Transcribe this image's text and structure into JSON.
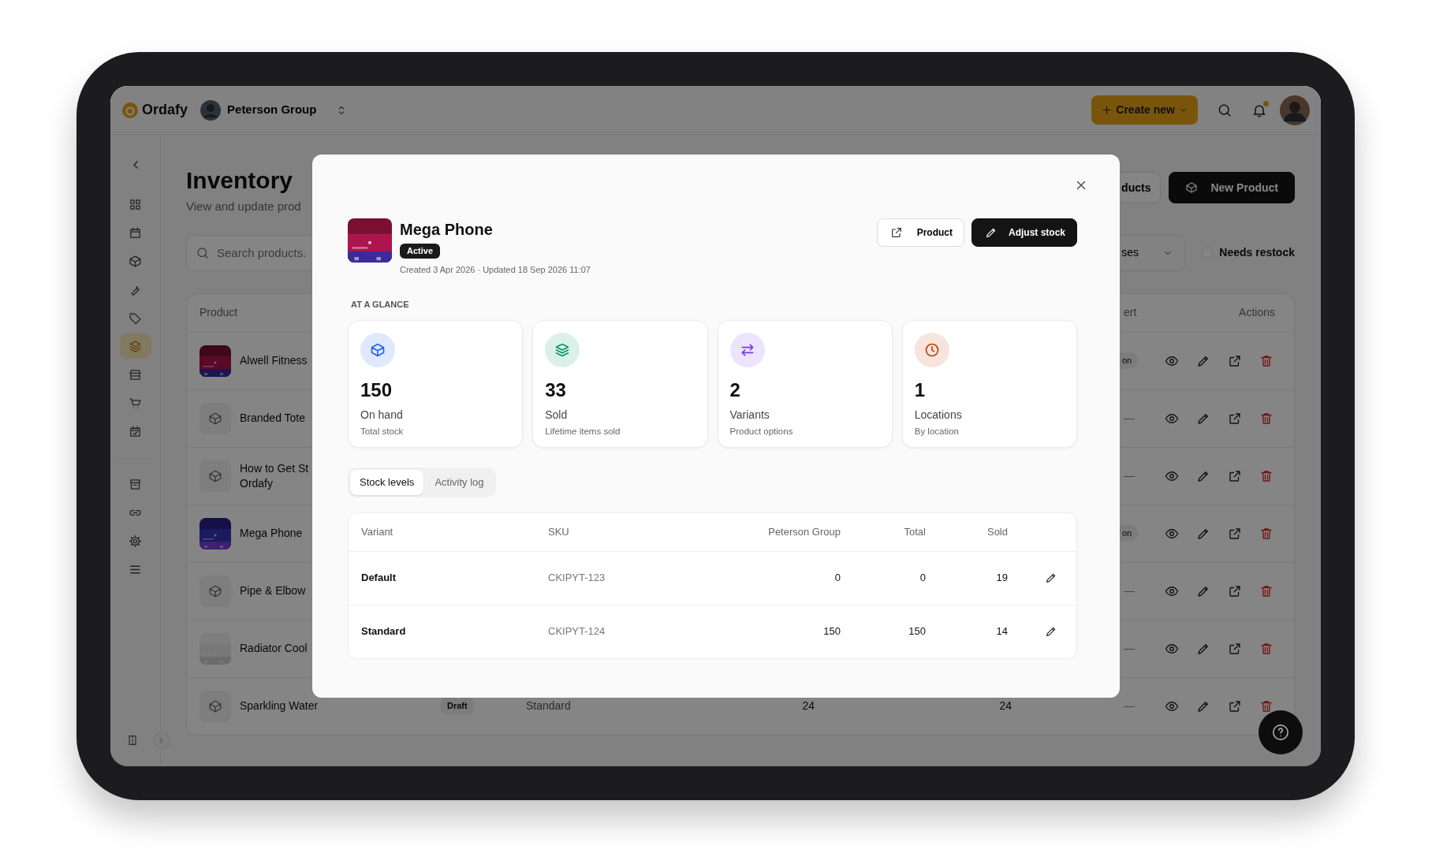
{
  "app": {
    "name": "Ordafy",
    "workspace": "Peterson Group",
    "create_button": "Create new",
    "notifications_unread": true
  },
  "sidebar": {
    "primary": [
      {
        "selected": false
      },
      {
        "selected": false
      },
      {
        "selected": false
      },
      {
        "selected": false
      },
      {
        "selected": false
      },
      {
        "selected": true
      },
      {
        "selected": false
      },
      {
        "selected": false
      },
      {
        "selected": false
      }
    ],
    "secondary": [
      {
        "selected": false
      },
      {
        "selected": false
      },
      {
        "selected": false
      },
      {
        "selected": false
      }
    ]
  },
  "page": {
    "title": "Inventory",
    "subtitle": "View and update prod",
    "buttons": [
      {
        "label": "ducts",
        "kind": "outline"
      },
      {
        "label": "New Product",
        "kind": "primary"
      }
    ],
    "search": {
      "placeholder": "Search products."
    },
    "filter": {
      "value": "ses"
    },
    "needs_restock": {
      "label": "Needs restock",
      "checked": false
    }
  },
  "table": {
    "columns": [
      "Product",
      "ert",
      "Actions"
    ],
    "rows": [
      {
        "name": "Alwell Fitness",
        "kind": "picture",
        "alert": {
          "kind": "badge",
          "text": "on"
        }
      },
      {
        "name": "Branded Tote",
        "kind": "placeholder",
        "alert": {
          "kind": "dash",
          "text": "—"
        }
      },
      {
        "name": "How to Get St\nOrdafy",
        "kind": "placeholder",
        "alert": {
          "kind": "dash",
          "text": "—"
        }
      },
      {
        "name": "Mega Phone",
        "kind": "picture",
        "alert": {
          "kind": "badge",
          "text": "on"
        }
      },
      {
        "name": "Pipe & Elbow",
        "kind": "placeholder",
        "alert": {
          "kind": "dash",
          "text": "—"
        }
      },
      {
        "name": "Radiator Cool",
        "kind": "picture",
        "alert": {
          "kind": "dash",
          "text": "—"
        }
      },
      {
        "name": "Sparkling Water",
        "kind": "placeholder",
        "status": "Draft",
        "variant": "Standard",
        "stock": "24",
        "sold": "24",
        "alert": {
          "kind": "dash",
          "text": "—"
        }
      }
    ]
  },
  "modal": {
    "title": "Mega Phone",
    "status": "Active",
    "meta": "Created 3 Apr 2026 · Updated 18 Sep 2026 11:07",
    "buttons": [
      {
        "label": "Product",
        "kind": "outline"
      },
      {
        "label": "Adjust stock",
        "kind": "primary"
      }
    ],
    "section": "AT A GLANCE",
    "stats": [
      {
        "value": "150",
        "label": "On hand",
        "sub": "Total stock",
        "color": "#2563eb"
      },
      {
        "value": "33",
        "label": "Sold",
        "sub": "Lifetime items sold",
        "color": "#059669"
      },
      {
        "value": "2",
        "label": "Variants",
        "sub": "Product options",
        "color": "#7c3aed"
      },
      {
        "value": "1",
        "label": "Locations",
        "sub": "By location",
        "color": "#c2410c"
      }
    ],
    "tabs": [
      {
        "label": "Stock levels",
        "selected": true
      },
      {
        "label": "Activity log",
        "selected": false
      }
    ],
    "stock_table": {
      "columns": [
        "Variant",
        "SKU",
        "Peterson Group",
        "Total",
        "Sold"
      ],
      "rows": [
        {
          "variant": "Default",
          "sku": "CKIPYT-123",
          "location": "0",
          "total": "0",
          "sold": "19"
        },
        {
          "variant": "Standard",
          "sku": "CKIPYT-124",
          "location": "150",
          "total": "150",
          "sold": "14"
        }
      ]
    }
  }
}
